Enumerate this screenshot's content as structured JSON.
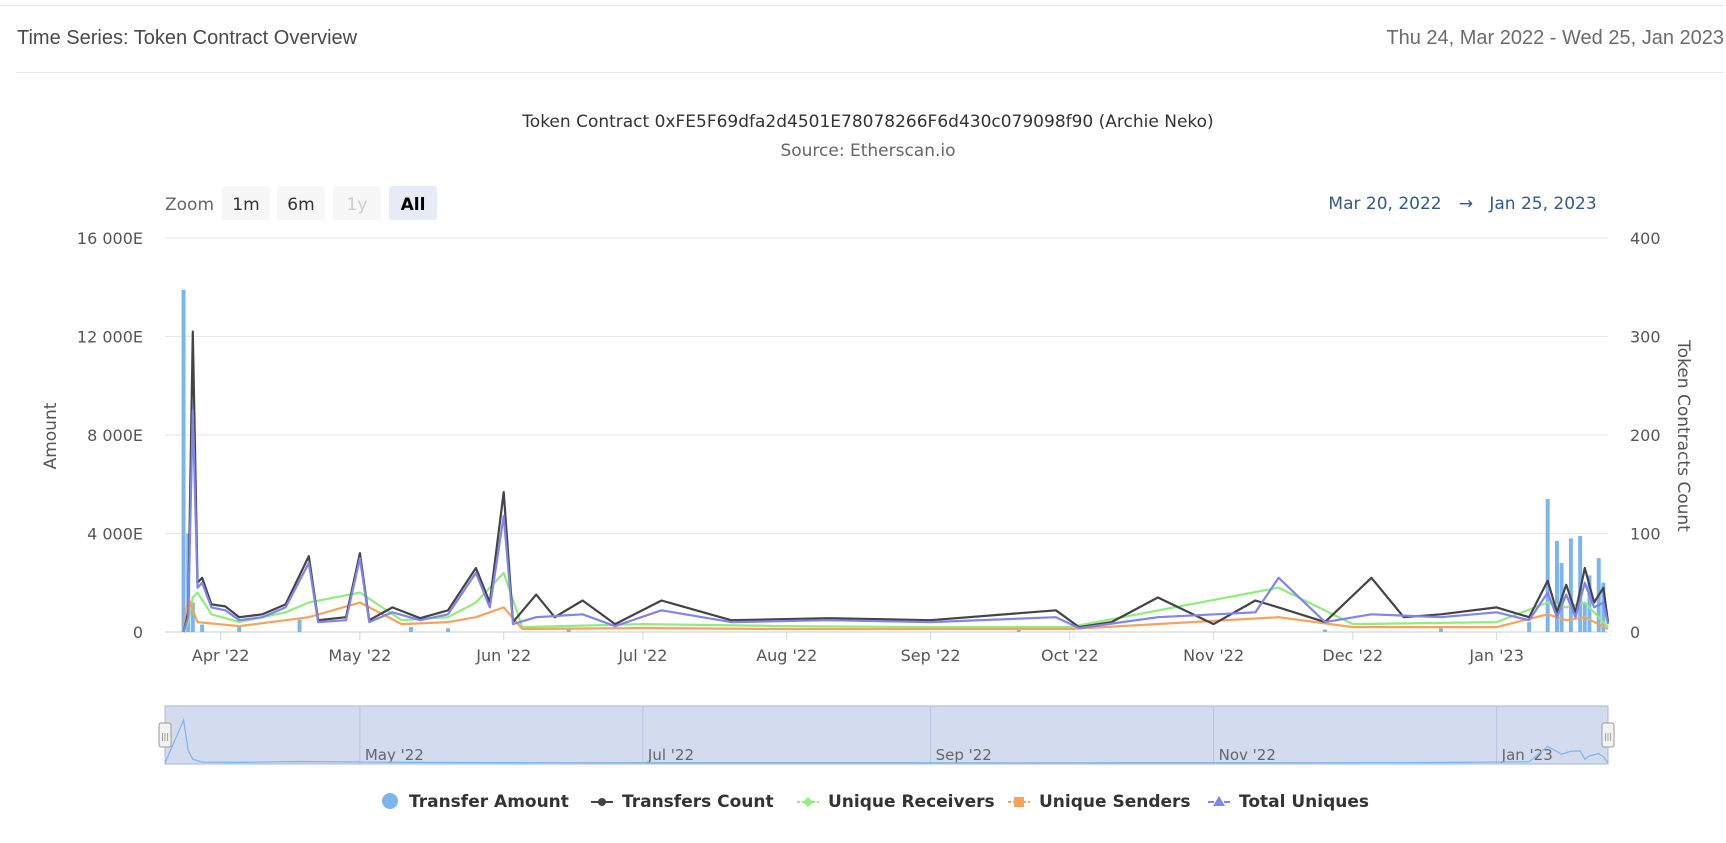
{
  "header": {
    "title": "Time Series: Token Contract Overview",
    "date_range": "Thu 24, Mar 2022 - Wed 25, Jan 2023"
  },
  "range_selector": {
    "zoom_label": "Zoom",
    "buttons": [
      {
        "label": "1m",
        "state": "normal"
      },
      {
        "label": "6m",
        "state": "normal"
      },
      {
        "label": "1y",
        "state": "disabled"
      },
      {
        "label": "All",
        "state": "selected"
      }
    ],
    "from": "Mar 20, 2022",
    "arrow": "→",
    "to": "Jan 25, 2023"
  },
  "navigator": {
    "labels": [
      "May '22",
      "Jul '22",
      "Sep '22",
      "Nov '22",
      "Jan '23"
    ],
    "handle_glyph": "|||"
  },
  "colors": {
    "transfer_amount": "#7cb5ec",
    "transfers_count": "#434348",
    "unique_receivers": "#90ed7d",
    "unique_senders": "#f7a35c",
    "total_uniques": "#8085e9",
    "navigator_fill": "#d3dbef",
    "grid": "#e6e6e6",
    "range_text": "#335a8a"
  },
  "chart_data": {
    "type": "line",
    "title": "Token Contract 0xFE5F69dfa2d4501E78078266F6d430c079098f90 (Archie Neko)",
    "subtitle": "Source: Etherscan.io",
    "x_range": [
      "2022-03-20",
      "2023-01-25"
    ],
    "x_ticks": [
      {
        "date": "2022-04-01",
        "label": "Apr '22"
      },
      {
        "date": "2022-05-01",
        "label": "May '22"
      },
      {
        "date": "2022-06-01",
        "label": "Jun '22"
      },
      {
        "date": "2022-07-01",
        "label": "Jul '22"
      },
      {
        "date": "2022-08-01",
        "label": "Aug '22"
      },
      {
        "date": "2022-09-01",
        "label": "Sep '22"
      },
      {
        "date": "2022-10-01",
        "label": "Oct '22"
      },
      {
        "date": "2022-11-01",
        "label": "Nov '22"
      },
      {
        "date": "2022-12-01",
        "label": "Dec '22"
      },
      {
        "date": "2023-01-01",
        "label": "Jan '23"
      }
    ],
    "y_left": {
      "label": "Amount",
      "min": 0,
      "max": 16000,
      "ticks": [
        0,
        4000,
        8000,
        12000,
        16000
      ],
      "tick_labels": [
        "0",
        "4 000E",
        "8 000E",
        "12 000E",
        "16 000E"
      ]
    },
    "y_right": {
      "label": "Token Contracts Count",
      "min": 0,
      "max": 400,
      "ticks": [
        0,
        100,
        200,
        300,
        400
      ],
      "tick_labels": [
        "0",
        "100",
        "200",
        "300",
        "400"
      ]
    },
    "grid": true,
    "legend_position": "bottom",
    "series": [
      {
        "name": "Transfer Amount",
        "type": "bar",
        "axis": "left",
        "points": [
          [
            "2022-03-24",
            13900
          ],
          [
            "2022-03-25",
            4000
          ],
          [
            "2022-03-26",
            1200
          ],
          [
            "2022-03-28",
            300
          ],
          [
            "2022-04-05",
            200
          ],
          [
            "2022-04-18",
            500
          ],
          [
            "2022-05-12",
            200
          ],
          [
            "2022-05-20",
            150
          ],
          [
            "2022-06-15",
            100
          ],
          [
            "2022-09-20",
            80
          ],
          [
            "2022-11-25",
            100
          ],
          [
            "2022-12-20",
            150
          ],
          [
            "2023-01-08",
            400
          ],
          [
            "2023-01-12",
            5400
          ],
          [
            "2023-01-14",
            3700
          ],
          [
            "2023-01-15",
            2800
          ],
          [
            "2023-01-17",
            3800
          ],
          [
            "2023-01-19",
            3900
          ],
          [
            "2023-01-20",
            1200
          ],
          [
            "2023-01-21",
            2300
          ],
          [
            "2023-01-23",
            3000
          ],
          [
            "2023-01-24",
            2000
          ]
        ]
      },
      {
        "name": "Transfers Count",
        "type": "line",
        "axis": "right",
        "points": [
          [
            "2022-03-24",
            0
          ],
          [
            "2022-03-25",
            20
          ],
          [
            "2022-03-26",
            305
          ],
          [
            "2022-03-27",
            50
          ],
          [
            "2022-03-28",
            55
          ],
          [
            "2022-03-30",
            28
          ],
          [
            "2022-04-02",
            26
          ],
          [
            "2022-04-05",
            15
          ],
          [
            "2022-04-10",
            18
          ],
          [
            "2022-04-15",
            28
          ],
          [
            "2022-04-20",
            77
          ],
          [
            "2022-04-22",
            12
          ],
          [
            "2022-04-28",
            15
          ],
          [
            "2022-05-01",
            80
          ],
          [
            "2022-05-03",
            12
          ],
          [
            "2022-05-08",
            25
          ],
          [
            "2022-05-14",
            14
          ],
          [
            "2022-05-20",
            22
          ],
          [
            "2022-05-26",
            65
          ],
          [
            "2022-05-29",
            30
          ],
          [
            "2022-06-01",
            142
          ],
          [
            "2022-06-03",
            10
          ],
          [
            "2022-06-08",
            38
          ],
          [
            "2022-06-12",
            15
          ],
          [
            "2022-06-18",
            32
          ],
          [
            "2022-06-25",
            8
          ],
          [
            "2022-07-05",
            32
          ],
          [
            "2022-07-08",
            28
          ],
          [
            "2022-07-20",
            12
          ],
          [
            "2022-08-10",
            14
          ],
          [
            "2022-09-01",
            12
          ],
          [
            "2022-09-28",
            22
          ],
          [
            "2022-10-03",
            5
          ],
          [
            "2022-10-10",
            10
          ],
          [
            "2022-10-20",
            35
          ],
          [
            "2022-11-01",
            8
          ],
          [
            "2022-11-10",
            32
          ],
          [
            "2022-11-15",
            25
          ],
          [
            "2022-11-25",
            10
          ],
          [
            "2022-12-05",
            55
          ],
          [
            "2022-12-12",
            15
          ],
          [
            "2022-12-20",
            18
          ],
          [
            "2023-01-01",
            25
          ],
          [
            "2023-01-08",
            15
          ],
          [
            "2023-01-12",
            52
          ],
          [
            "2023-01-14",
            20
          ],
          [
            "2023-01-16",
            48
          ],
          [
            "2023-01-18",
            20
          ],
          [
            "2023-01-20",
            65
          ],
          [
            "2023-01-22",
            30
          ],
          [
            "2023-01-24",
            45
          ],
          [
            "2023-01-25",
            10
          ]
        ]
      },
      {
        "name": "Unique Receivers",
        "type": "line",
        "axis": "right",
        "points": [
          [
            "2022-03-24",
            0
          ],
          [
            "2022-03-25",
            10
          ],
          [
            "2022-03-26",
            35
          ],
          [
            "2022-03-27",
            40
          ],
          [
            "2022-03-30",
            18
          ],
          [
            "2022-04-05",
            10
          ],
          [
            "2022-04-15",
            20
          ],
          [
            "2022-04-20",
            30
          ],
          [
            "2022-05-01",
            40
          ],
          [
            "2022-05-10",
            12
          ],
          [
            "2022-05-20",
            15
          ],
          [
            "2022-05-26",
            30
          ],
          [
            "2022-06-01",
            60
          ],
          [
            "2022-06-05",
            5
          ],
          [
            "2022-07-01",
            8
          ],
          [
            "2022-08-01",
            6
          ],
          [
            "2022-09-01",
            5
          ],
          [
            "2022-10-01",
            5
          ],
          [
            "2022-11-15",
            45
          ],
          [
            "2022-12-01",
            8
          ],
          [
            "2023-01-01",
            10
          ],
          [
            "2023-01-12",
            30
          ],
          [
            "2023-01-16",
            25
          ],
          [
            "2023-01-20",
            30
          ],
          [
            "2023-01-25",
            5
          ]
        ]
      },
      {
        "name": "Unique Senders",
        "type": "line",
        "axis": "right",
        "points": [
          [
            "2022-03-24",
            0
          ],
          [
            "2022-03-25",
            35
          ],
          [
            "2022-03-27",
            10
          ],
          [
            "2022-04-05",
            6
          ],
          [
            "2022-04-20",
            15
          ],
          [
            "2022-05-01",
            30
          ],
          [
            "2022-05-10",
            8
          ],
          [
            "2022-05-20",
            10
          ],
          [
            "2022-05-26",
            15
          ],
          [
            "2022-06-01",
            25
          ],
          [
            "2022-06-05",
            3
          ],
          [
            "2022-07-01",
            4
          ],
          [
            "2022-08-01",
            3
          ],
          [
            "2022-09-01",
            3
          ],
          [
            "2022-10-01",
            3
          ],
          [
            "2022-11-15",
            15
          ],
          [
            "2022-12-01",
            5
          ],
          [
            "2023-01-01",
            5
          ],
          [
            "2023-01-12",
            18
          ],
          [
            "2023-01-16",
            12
          ],
          [
            "2023-01-20",
            15
          ],
          [
            "2023-01-25",
            3
          ]
        ]
      },
      {
        "name": "Total Uniques",
        "type": "line",
        "axis": "right",
        "points": [
          [
            "2022-03-24",
            0
          ],
          [
            "2022-03-25",
            15
          ],
          [
            "2022-03-26",
            225
          ],
          [
            "2022-03-27",
            45
          ],
          [
            "2022-03-28",
            50
          ],
          [
            "2022-03-30",
            25
          ],
          [
            "2022-04-02",
            22
          ],
          [
            "2022-04-05",
            12
          ],
          [
            "2022-04-10",
            15
          ],
          [
            "2022-04-15",
            25
          ],
          [
            "2022-04-20",
            70
          ],
          [
            "2022-04-22",
            10
          ],
          [
            "2022-04-28",
            12
          ],
          [
            "2022-05-01",
            75
          ],
          [
            "2022-05-03",
            10
          ],
          [
            "2022-05-08",
            20
          ],
          [
            "2022-05-14",
            12
          ],
          [
            "2022-05-20",
            18
          ],
          [
            "2022-05-26",
            60
          ],
          [
            "2022-05-29",
            25
          ],
          [
            "2022-06-01",
            118
          ],
          [
            "2022-06-03",
            8
          ],
          [
            "2022-06-08",
            15
          ],
          [
            "2022-06-18",
            18
          ],
          [
            "2022-06-25",
            6
          ],
          [
            "2022-07-05",
            22
          ],
          [
            "2022-07-20",
            10
          ],
          [
            "2022-08-10",
            12
          ],
          [
            "2022-09-01",
            10
          ],
          [
            "2022-09-28",
            15
          ],
          [
            "2022-10-03",
            4
          ],
          [
            "2022-10-20",
            15
          ],
          [
            "2022-11-10",
            20
          ],
          [
            "2022-11-15",
            55
          ],
          [
            "2022-11-25",
            10
          ],
          [
            "2022-12-05",
            18
          ],
          [
            "2022-12-20",
            15
          ],
          [
            "2023-01-01",
            20
          ],
          [
            "2023-01-08",
            12
          ],
          [
            "2023-01-12",
            40
          ],
          [
            "2023-01-14",
            15
          ],
          [
            "2023-01-16",
            38
          ],
          [
            "2023-01-18",
            15
          ],
          [
            "2023-01-20",
            50
          ],
          [
            "2023-01-22",
            25
          ],
          [
            "2023-01-24",
            30
          ],
          [
            "2023-01-25",
            8
          ]
        ]
      }
    ]
  }
}
